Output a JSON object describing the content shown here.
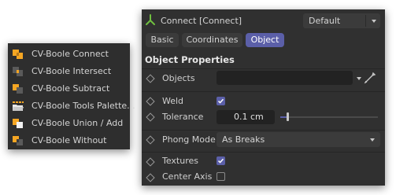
{
  "menu": {
    "items": [
      {
        "label": "CV-Boole Connect",
        "icon": "boole-connect-icon"
      },
      {
        "label": "CV-Boole Intersect",
        "icon": "boole-intersect-icon"
      },
      {
        "label": "CV-Boole Subtract",
        "icon": "boole-subtract-icon"
      },
      {
        "label": "CV-Boole Tools Palette...",
        "icon": "folder-icon"
      },
      {
        "label": "CV-Boole Union / Add",
        "icon": "boole-union-icon"
      },
      {
        "label": "CV-Boole Without",
        "icon": "boole-without-icon"
      }
    ]
  },
  "panel": {
    "title": "Connect [Connect]",
    "mode_select": "Default",
    "tabs": [
      {
        "label": "Basic",
        "active": false
      },
      {
        "label": "Coordinates",
        "active": false
      },
      {
        "label": "Object",
        "active": true
      }
    ],
    "section_title": "Object Properties",
    "objects_label": "Objects",
    "weld_label": "Weld",
    "weld_checked": true,
    "tolerance_label": "Tolerance",
    "tolerance_value": "0.1 cm",
    "phong_label": "Phong Mode",
    "phong_value": "As Breaks",
    "textures_label": "Textures",
    "textures_checked": true,
    "center_axis_label": "Center Axis",
    "center_axis_checked": false
  },
  "colors": {
    "accent": "#5b5fa8",
    "panel_bg": "#303030",
    "menu_bg": "#2e2e2e",
    "icon_orange": "#f5a623",
    "connect_icon_green": "#6fbf3f"
  }
}
